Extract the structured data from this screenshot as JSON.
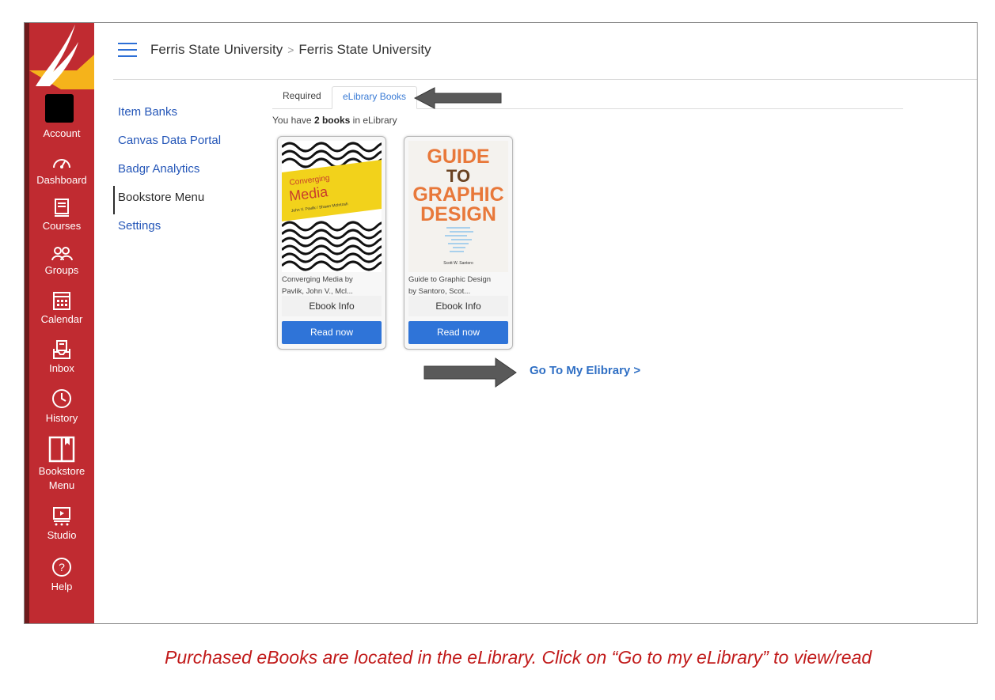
{
  "nav": {
    "items": [
      {
        "label": "Account",
        "icon": "account-avatar"
      },
      {
        "label": "Dashboard",
        "icon": "dashboard-icon"
      },
      {
        "label": "Courses",
        "icon": "courses-icon"
      },
      {
        "label": "Groups",
        "icon": "groups-icon"
      },
      {
        "label": "Calendar",
        "icon": "calendar-icon"
      },
      {
        "label": "Inbox",
        "icon": "inbox-icon"
      },
      {
        "label": "History",
        "icon": "history-icon"
      },
      {
        "label": "Bookstore",
        "label2": "Menu",
        "icon": "bookstore-icon"
      },
      {
        "label": "Studio",
        "icon": "studio-icon"
      },
      {
        "label": "Help",
        "icon": "help-icon"
      }
    ]
  },
  "header": {
    "crumb1": "Ferris State University",
    "separator": ">",
    "crumb2": "Ferris State University"
  },
  "course_nav": {
    "items": [
      "Item Banks",
      "Canvas Data Portal",
      "Badgr Analytics",
      "Bookstore Menu",
      "Settings"
    ],
    "active": "Bookstore Menu"
  },
  "tabs": {
    "required": "Required",
    "elibrary": "eLibrary Books"
  },
  "count": {
    "prefix": "You have ",
    "bold": "2 books",
    "suffix": " in eLibrary"
  },
  "books": [
    {
      "title_line1": "Converging Media by",
      "title_line2": "Pavlik, John V., Mcl...",
      "info_label": "Ebook Info",
      "read_label": "Read now",
      "cover_word1": "Converging",
      "cover_word2": "Media",
      "cover_authors": "John V. Pavlik / Shawn McIntosh"
    },
    {
      "title_line1": "Guide to Graphic Design",
      "title_line2": "by Santoro, Scot...",
      "info_label": "Ebook Info",
      "read_label": "Read now",
      "cover_word1": "GUIDE",
      "cover_word2": "TO",
      "cover_word3": "GRAPHIC",
      "cover_word4": "DESIGN",
      "cover_authors": "Scott W. Santoro"
    }
  ],
  "go_link": "Go To My Elibrary >",
  "caption": "Purchased eBooks are located in the eLibrary. Click on “Go to my eLibrary” to view/read",
  "colors": {
    "nav": "#c02b31",
    "link": "#2f6fc4",
    "button": "#2f74d8",
    "caption": "#c11a1a"
  }
}
